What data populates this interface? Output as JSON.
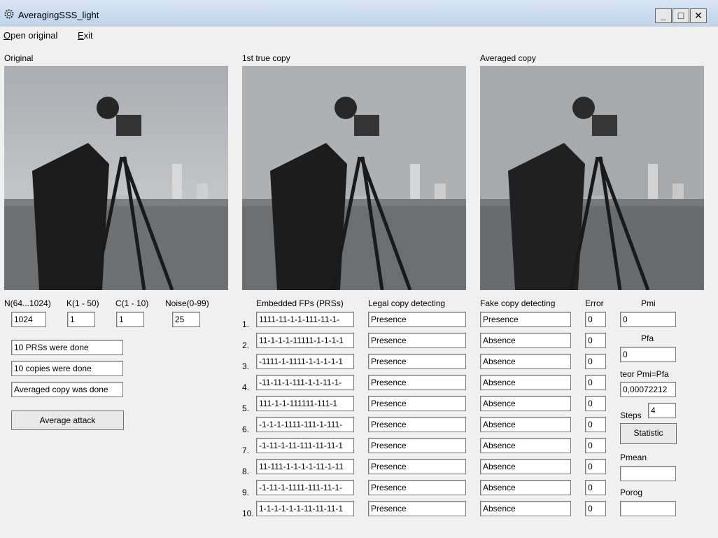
{
  "window": {
    "title": "AveragingSSS_light"
  },
  "menu": {
    "open_mn": "O",
    "open_rest": "pen original",
    "exit_mn": "E",
    "exit_rest": "xit"
  },
  "panels": {
    "original_label": "Original",
    "true_copy_label": "1st true copy",
    "averaged_label": "Averaged copy"
  },
  "params": {
    "n_label": "N(64...1024)",
    "n_value": "1024",
    "k_label": "K(1 - 50)",
    "k_value": "1",
    "c_label": "C(1 - 10)",
    "c_value": "1",
    "noise_label": "Noise(0-99)",
    "noise_value": "25"
  },
  "status": [
    "10 PRSs were done",
    "10 copies were done",
    "Averaged copy was done"
  ],
  "buttons": {
    "average_attack": "Average attack",
    "statistic": "Statistic"
  },
  "table": {
    "headers": {
      "embedded": "Embedded FPs (PRSs)",
      "legal": "Legal copy detecting",
      "fake": "Fake copy detecting",
      "error": "Error"
    },
    "rows": [
      {
        "no": "1.",
        "fp": "1111-11-1-1-111-11-1-",
        "legal": "Presence",
        "fake": "Presence",
        "error": "0"
      },
      {
        "no": "2.",
        "fp": "11-1-1-1-11111-1-1-1-1",
        "legal": "Presence",
        "fake": "Absence",
        "error": "0"
      },
      {
        "no": "3.",
        "fp": "-1111-1-1111-1-1-1-1-1",
        "legal": "Presence",
        "fake": "Absence",
        "error": "0"
      },
      {
        "no": "4.",
        "fp": "-11-11-1-111-1-1-11-1-",
        "legal": "Presence",
        "fake": "Absence",
        "error": "0"
      },
      {
        "no": "5.",
        "fp": "111-1-1-111111-111-1",
        "legal": "Presence",
        "fake": "Absence",
        "error": "0"
      },
      {
        "no": "6.",
        "fp": "-1-1-1-1111-111-1-111-",
        "legal": "Presence",
        "fake": "Absence",
        "error": "0"
      },
      {
        "no": "7.",
        "fp": "-1-11-1-11-111-11-11-1",
        "legal": "Presence",
        "fake": "Absence",
        "error": "0"
      },
      {
        "no": "8.",
        "fp": "11-111-1-1-1-1-11-1-11",
        "legal": "Presence",
        "fake": "Absence",
        "error": "0"
      },
      {
        "no": "9.",
        "fp": "-1-11-1-1111-111-11-1-",
        "legal": "Presence",
        "fake": "Absence",
        "error": "0"
      },
      {
        "no": "10.",
        "fp": "1-1-1-1-1-1-11-11-11-1",
        "legal": "Presence",
        "fake": "Absence",
        "error": "0"
      }
    ]
  },
  "stats": {
    "pmi_label": "Pmi",
    "pmi_value": "0",
    "pfa_label": "Pfa",
    "pfa_value": "0",
    "teor_label": "teor Pmi=Pfa",
    "teor_value": "0,00072212",
    "steps_label": "Steps",
    "steps_value": "4",
    "pmean_label": "Pmean",
    "pmean_value": "",
    "porog_label": "Porog",
    "porog_value": ""
  }
}
